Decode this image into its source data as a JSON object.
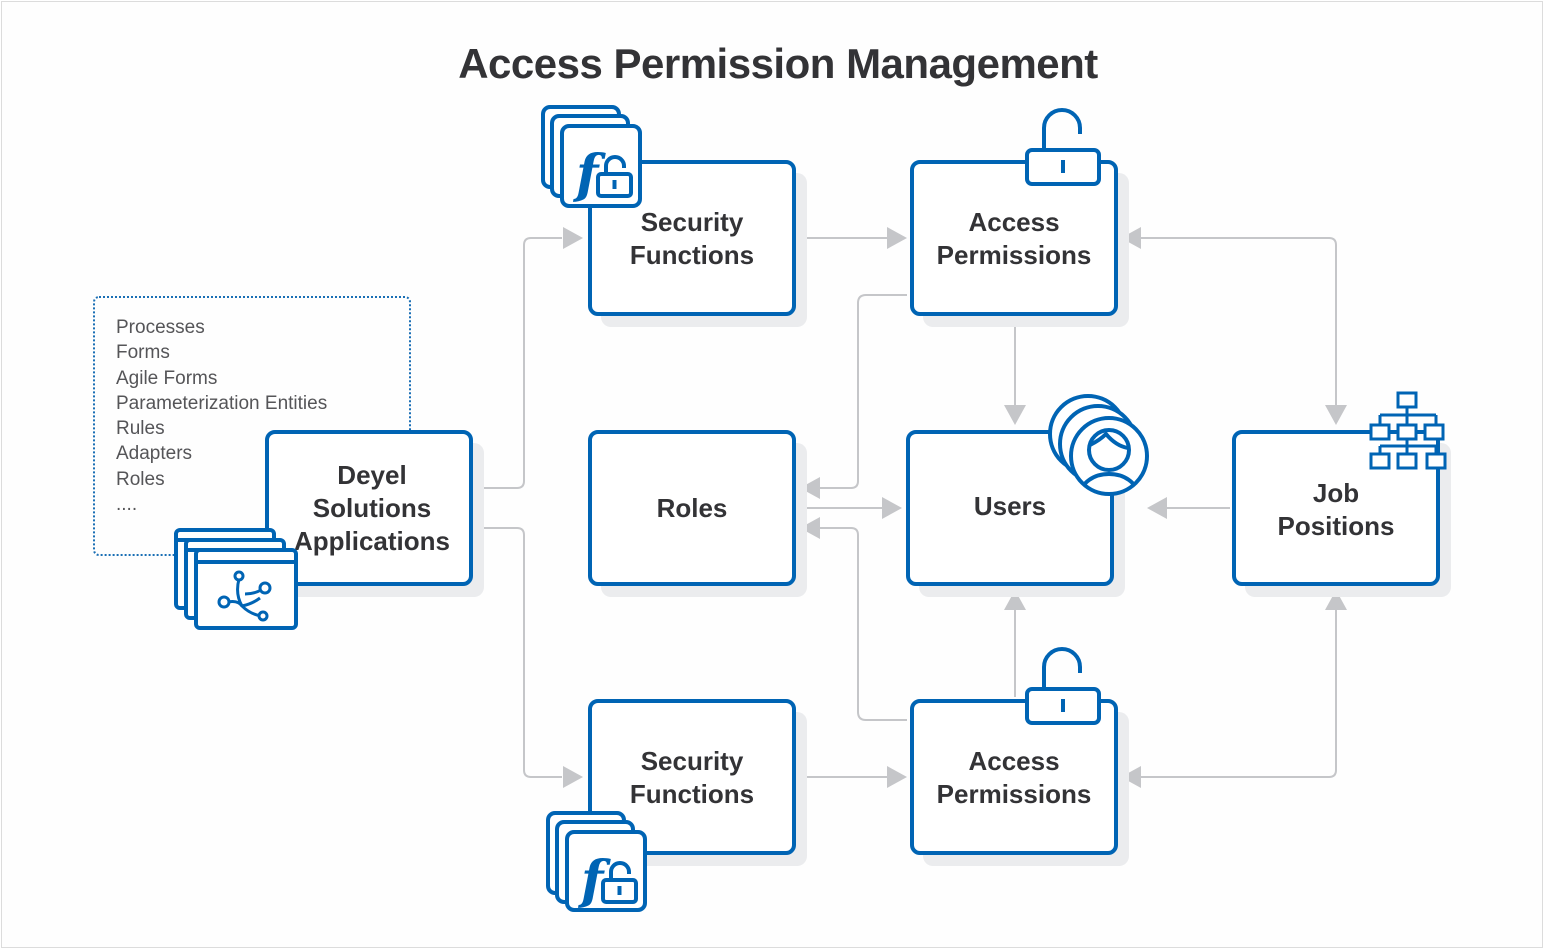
{
  "title": "Access Permission Management",
  "colors": {
    "accent": "#0064b4",
    "text": "#333336",
    "connector": "#c5c6c9",
    "shadow": "#ebecee",
    "list_text": "#555558"
  },
  "artifact_list": {
    "items": [
      "Processes",
      "Forms",
      "Agile Forms",
      "Parameterization Entities",
      "Rules",
      "Adapters",
      "Roles",
      "...."
    ]
  },
  "nodes": {
    "deyel": {
      "label": "Deyel\nSolutions\nApplications",
      "icon": "application-windows-icon"
    },
    "security_functions_top": {
      "label": "Security\nFunctions",
      "icon": "function-lock-stack-icon"
    },
    "access_permissions_top": {
      "label": "Access\nPermissions",
      "icon": "open-padlock-icon"
    },
    "roles": {
      "label": "Roles"
    },
    "users": {
      "label": "Users",
      "icon": "users-stack-icon"
    },
    "job_positions": {
      "label": "Job\nPositions",
      "icon": "org-chart-icon"
    },
    "security_functions_bottom": {
      "label": "Security\nFunctions",
      "icon": "function-lock-stack-icon"
    },
    "access_permissions_bottom": {
      "label": "Access\nPermissions",
      "icon": "open-padlock-icon"
    }
  },
  "connections": [
    {
      "from": "Deyel Solutions Applications",
      "to": "Security Functions (top)"
    },
    {
      "from": "Deyel Solutions Applications",
      "to": "Security Functions (bottom)"
    },
    {
      "from": "Security Functions (top)",
      "to": "Access Permissions (top)"
    },
    {
      "from": "Security Functions (bottom)",
      "to": "Access Permissions (bottom)"
    },
    {
      "from": "Access Permissions (top)",
      "to": "Users"
    },
    {
      "from": "Access Permissions (top)",
      "to": "Roles"
    },
    {
      "from": "Access Permissions (bottom)",
      "to": "Users"
    },
    {
      "from": "Access Permissions (bottom)",
      "to": "Roles"
    },
    {
      "from": "Roles",
      "to": "Users"
    },
    {
      "from": "Job Positions",
      "to": "Users"
    },
    {
      "from": "Job Positions",
      "to": "Access Permissions (top)",
      "bidirectional": true
    },
    {
      "from": "Job Positions",
      "to": "Access Permissions (bottom)",
      "bidirectional": true
    }
  ]
}
